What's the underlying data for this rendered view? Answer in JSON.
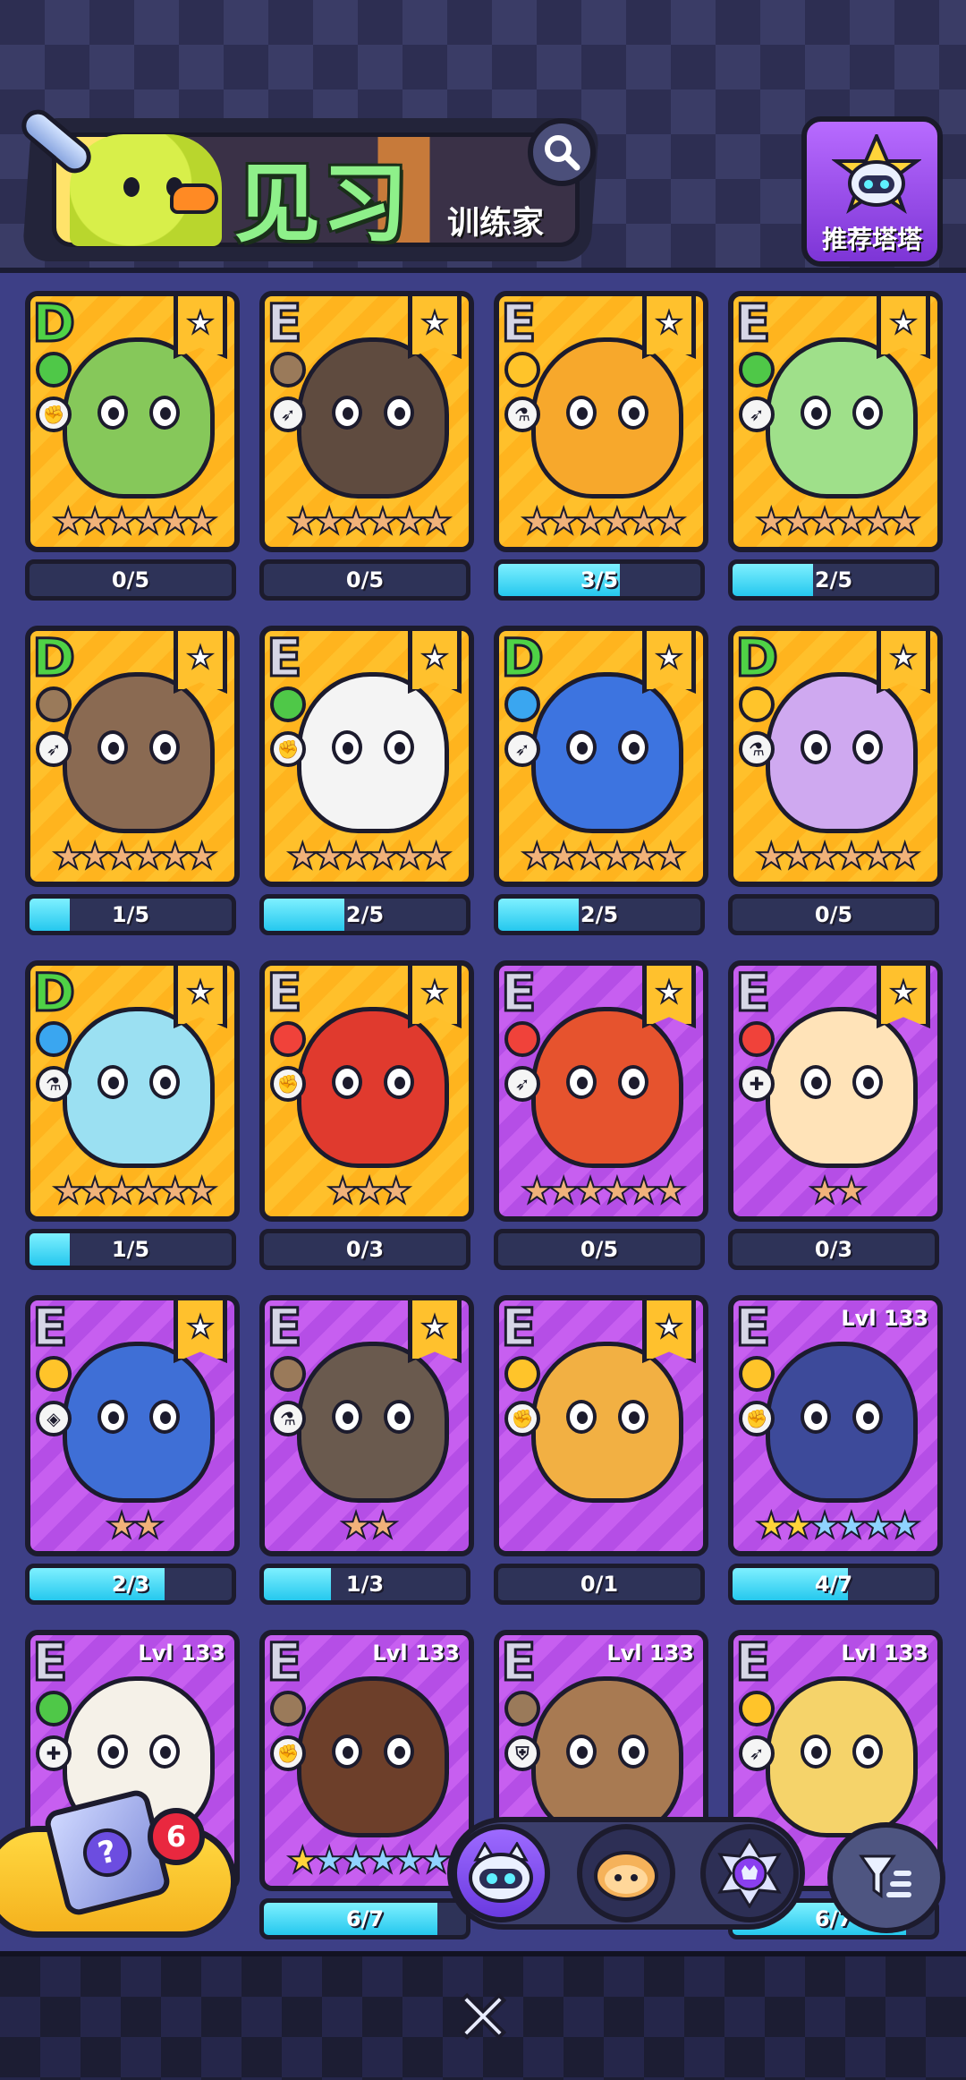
{
  "header": {
    "title_main": "见习",
    "title_sub": "训练家",
    "search_icon": "search-icon",
    "recommend_label": "推荐塔塔"
  },
  "cards": [
    {
      "rank": "D",
      "type": "grass",
      "role": "melee",
      "flag": true,
      "lvl": "",
      "stars": [
        "bronze",
        "bronze",
        "bronze",
        "bronze",
        "bronze",
        "bronze"
      ],
      "progress": "0/5",
      "pct": 0,
      "bg": "gold",
      "creature_color": "#86c85a"
    },
    {
      "rank": "E",
      "type": "earth",
      "role": "ranged",
      "flag": true,
      "lvl": "",
      "stars": [
        "bronze",
        "bronze",
        "bronze",
        "bronze",
        "bronze",
        "bronze"
      ],
      "progress": "0/5",
      "pct": 0,
      "bg": "gold",
      "creature_color": "#5f4b3f"
    },
    {
      "rank": "E",
      "type": "electric",
      "role": "mage",
      "flag": true,
      "lvl": "",
      "stars": [
        "bronze",
        "bronze",
        "bronze",
        "bronze",
        "bronze",
        "bronze"
      ],
      "progress": "3/5",
      "pct": 60,
      "bg": "gold",
      "creature_color": "#f7a82c"
    },
    {
      "rank": "E",
      "type": "grass",
      "role": "ranged",
      "flag": true,
      "lvl": "",
      "stars": [
        "bronze",
        "bronze",
        "bronze",
        "bronze",
        "bronze",
        "bronze"
      ],
      "progress": "2/5",
      "pct": 40,
      "bg": "gold",
      "creature_color": "#9fe08a"
    },
    {
      "rank": "D",
      "type": "earth",
      "role": "ranged",
      "flag": true,
      "lvl": "",
      "stars": [
        "bronze",
        "bronze",
        "bronze",
        "bronze",
        "bronze",
        "bronze"
      ],
      "progress": "1/5",
      "pct": 20,
      "bg": "gold",
      "creature_color": "#8a6a52"
    },
    {
      "rank": "E",
      "type": "grass",
      "role": "melee",
      "flag": true,
      "lvl": "",
      "stars": [
        "bronze",
        "bronze",
        "bronze",
        "bronze",
        "bronze",
        "bronze"
      ],
      "progress": "2/5",
      "pct": 40,
      "bg": "gold",
      "creature_color": "#f4f4f4"
    },
    {
      "rank": "D",
      "type": "water",
      "role": "ranged",
      "flag": true,
      "lvl": "",
      "stars": [
        "bronze",
        "bronze",
        "bronze",
        "bronze",
        "bronze",
        "bronze"
      ],
      "progress": "2/5",
      "pct": 40,
      "bg": "gold",
      "creature_color": "#3d74e0"
    },
    {
      "rank": "D",
      "type": "electric",
      "role": "mage",
      "flag": true,
      "lvl": "",
      "stars": [
        "bronze",
        "bronze",
        "bronze",
        "bronze",
        "bronze",
        "bronze"
      ],
      "progress": "0/5",
      "pct": 0,
      "bg": "gold",
      "creature_color": "#cfa9f0"
    },
    {
      "rank": "D",
      "type": "water",
      "role": "mage",
      "flag": true,
      "lvl": "",
      "stars": [
        "bronze",
        "bronze",
        "bronze",
        "bronze",
        "bronze",
        "bronze"
      ],
      "progress": "1/5",
      "pct": 20,
      "bg": "gold",
      "creature_color": "#9be0f2"
    },
    {
      "rank": "E",
      "type": "fire",
      "role": "melee",
      "flag": true,
      "lvl": "",
      "stars": [
        "bronze",
        "bronze",
        "bronze"
      ],
      "progress": "0/3",
      "pct": 0,
      "bg": "gold",
      "creature_color": "#e03a2e"
    },
    {
      "rank": "E",
      "type": "fire",
      "role": "ranged",
      "flag": true,
      "lvl": "",
      "stars": [
        "bronze",
        "bronze",
        "bronze",
        "bronze",
        "bronze",
        "bronze"
      ],
      "progress": "0/5",
      "pct": 0,
      "bg": "purple",
      "creature_color": "#e6532e"
    },
    {
      "rank": "E",
      "type": "fire",
      "role": "support",
      "flag": true,
      "lvl": "",
      "stars": [
        "bronze",
        "bronze"
      ],
      "progress": "0/3",
      "pct": 0,
      "bg": "purple",
      "creature_color": "#ffe3b8"
    },
    {
      "rank": "E",
      "type": "electric",
      "role": "tank",
      "flag": true,
      "lvl": "",
      "stars": [
        "bronze",
        "bronze"
      ],
      "progress": "2/3",
      "pct": 67,
      "bg": "purple",
      "creature_color": "#3f6fd6"
    },
    {
      "rank": "E",
      "type": "earth",
      "role": "mage",
      "flag": true,
      "lvl": "",
      "stars": [
        "bronze",
        "bronze"
      ],
      "progress": "1/3",
      "pct": 33,
      "bg": "purple",
      "creature_color": "#6a5a4e"
    },
    {
      "rank": "E",
      "type": "electric",
      "role": "melee",
      "flag": true,
      "lvl": "",
      "stars": [],
      "progress": "0/1",
      "pct": 0,
      "bg": "purple",
      "creature_color": "#f2b043"
    },
    {
      "rank": "E",
      "type": "electric",
      "role": "melee",
      "flag": false,
      "lvl": "Lvl 133",
      "stars": [
        "gold",
        "gold",
        "blue",
        "blue",
        "blue",
        "blue"
      ],
      "progress": "4/7",
      "pct": 57,
      "bg": "purple",
      "creature_color": "#3d4a9a"
    },
    {
      "rank": "E",
      "type": "grass",
      "role": "support",
      "flag": false,
      "lvl": "Lvl 133",
      "stars": [],
      "progress": "",
      "pct": 0,
      "bg": "purple",
      "creature_color": "#f5f1e8"
    },
    {
      "rank": "E",
      "type": "earth",
      "role": "melee",
      "flag": false,
      "lvl": "Lvl 133",
      "stars": [
        "gold",
        "blue",
        "blue",
        "blue",
        "blue",
        "blue"
      ],
      "progress": "6/7",
      "pct": 86,
      "bg": "purple",
      "creature_color": "#6d3f2a"
    },
    {
      "rank": "E",
      "type": "earth",
      "role": "shield",
      "flag": false,
      "lvl": "Lvl 133",
      "stars": [],
      "progress": "",
      "pct": 0,
      "bg": "purple",
      "creature_color": "#a87a52"
    },
    {
      "rank": "E",
      "type": "electric",
      "role": "ranged",
      "flag": false,
      "lvl": "Lvl 133",
      "stars": [],
      "progress": "6/7",
      "pct": 86,
      "bg": "purple",
      "creature_color": "#f5d36a"
    }
  ],
  "type_colors": {
    "grass": "#4fc848",
    "earth": "#9a7a5a",
    "electric": "#ffc42a",
    "water": "#3aa6f0",
    "fire": "#f0423a"
  },
  "role_glyphs": {
    "melee": "✊",
    "ranged": "➶",
    "mage": "⚗",
    "support": "✚",
    "tank": "◈",
    "shield": "⛨"
  },
  "gift": {
    "count": "6",
    "icon": "mystery-box-icon"
  },
  "switcher": {
    "items": [
      "robot-cat-icon",
      "bread-icon",
      "crystal-icon"
    ]
  },
  "filter": {
    "icon": "filter-icon"
  },
  "close": {
    "label": "✕"
  }
}
